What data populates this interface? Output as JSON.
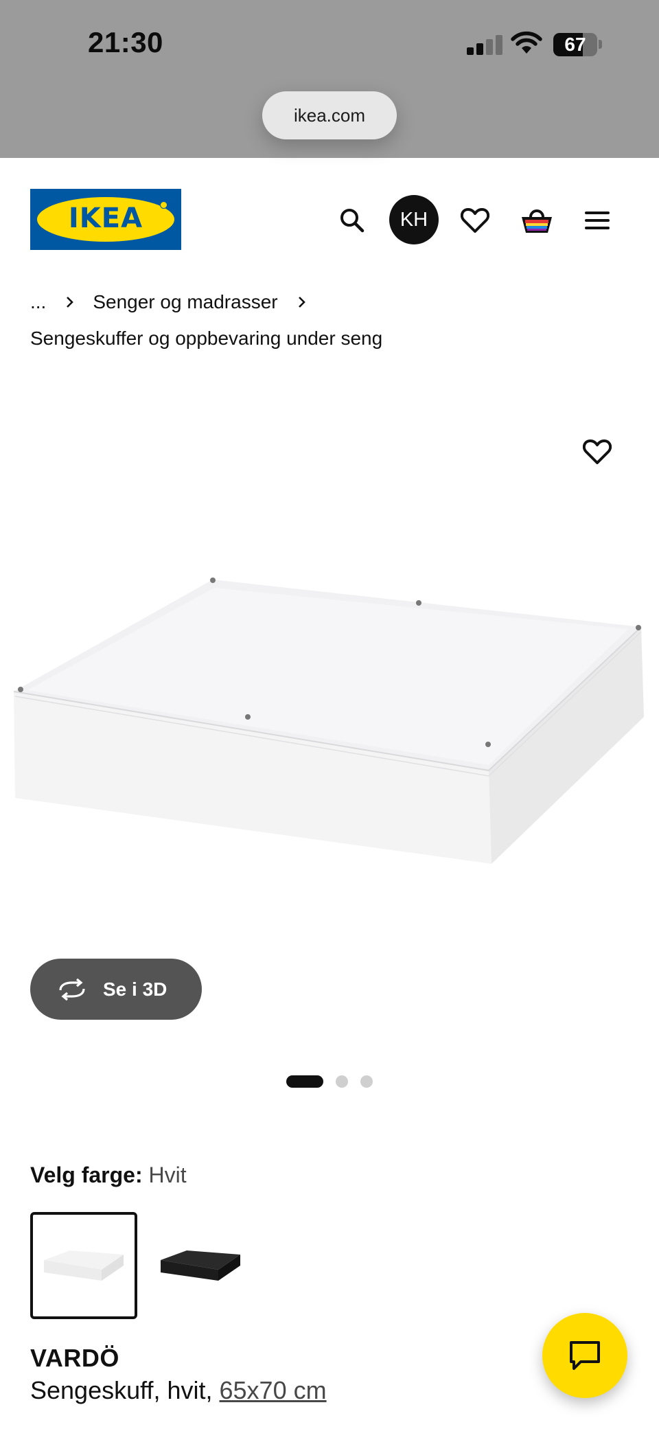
{
  "status_bar": {
    "time": "21:30",
    "battery": "67",
    "battery_fraction": 0.67,
    "url": "ikea.com"
  },
  "header": {
    "logo_text": "IKEA",
    "search_icon": "search-icon",
    "avatar_initials": "KH",
    "wishlist_icon": "heart-icon",
    "cart_icon": "shopping-basket-icon",
    "menu_icon": "hamburger-menu-icon",
    "brand_blue": "#0058a3",
    "brand_yellow": "#ffdb00"
  },
  "breadcrumb": {
    "ellipsis": "...",
    "parent": "Senger og madrasser",
    "current": "Sengeskuffer og oppbevaring under seng"
  },
  "gallery": {
    "favorite_icon": "heart-icon",
    "view_3d_label": "Se i 3D",
    "view_3d_icon": "rotate-3d-icon",
    "pages": 3,
    "active_page": 1
  },
  "color_selector": {
    "label": "Velg farge:",
    "selected": "Hvit",
    "swatches": [
      {
        "name": "white-swatch",
        "selected": true,
        "color": "#f3f3f3"
      },
      {
        "name": "black-swatch",
        "selected": false,
        "color": "#1e1e1e"
      }
    ]
  },
  "product": {
    "name": "VARDÖ",
    "description": "Sengeskuff, hvit,",
    "size": "65x70 cm"
  },
  "chat": {
    "icon": "chat-bubble-icon"
  }
}
